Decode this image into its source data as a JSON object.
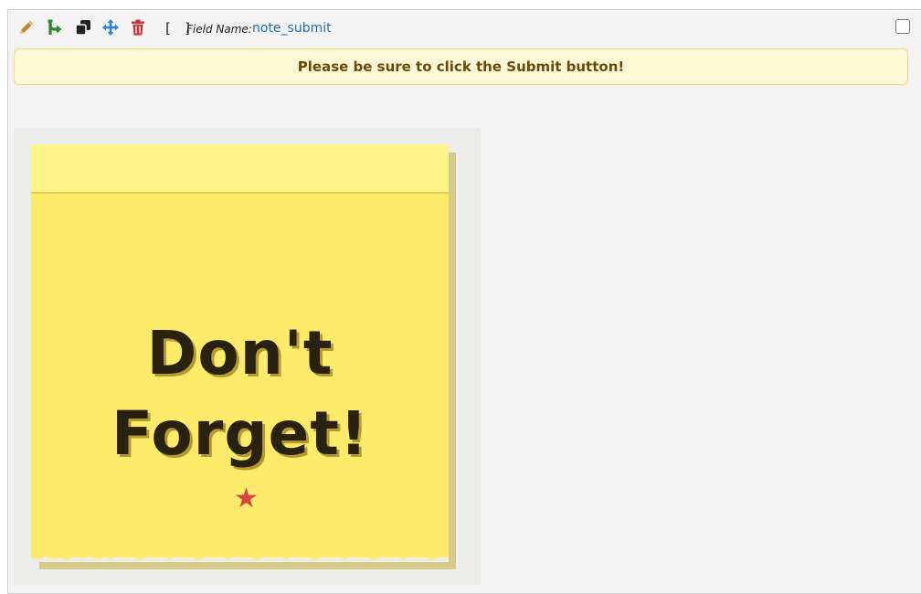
{
  "toolbar": {
    "icons": [
      {
        "name": "pencil-icon",
        "color": "#c8832e"
      },
      {
        "name": "branch-icon",
        "color": "#2a8a2a"
      },
      {
        "name": "copy-icon",
        "color": "#222222"
      },
      {
        "name": "move-icon",
        "color": "#2f83d4"
      },
      {
        "name": "trash-icon",
        "color": "#c8323a"
      }
    ],
    "brackets": "[ ]",
    "field_label": "Field Name:",
    "field_value": "note_submit"
  },
  "notice": {
    "text": "Please be sure to click the Submit button!"
  },
  "sticky_note": {
    "line1": "Don't",
    "line2": "Forget!",
    "star": "★",
    "note_color": "#ffeb6a",
    "star_color": "#d9423f"
  }
}
